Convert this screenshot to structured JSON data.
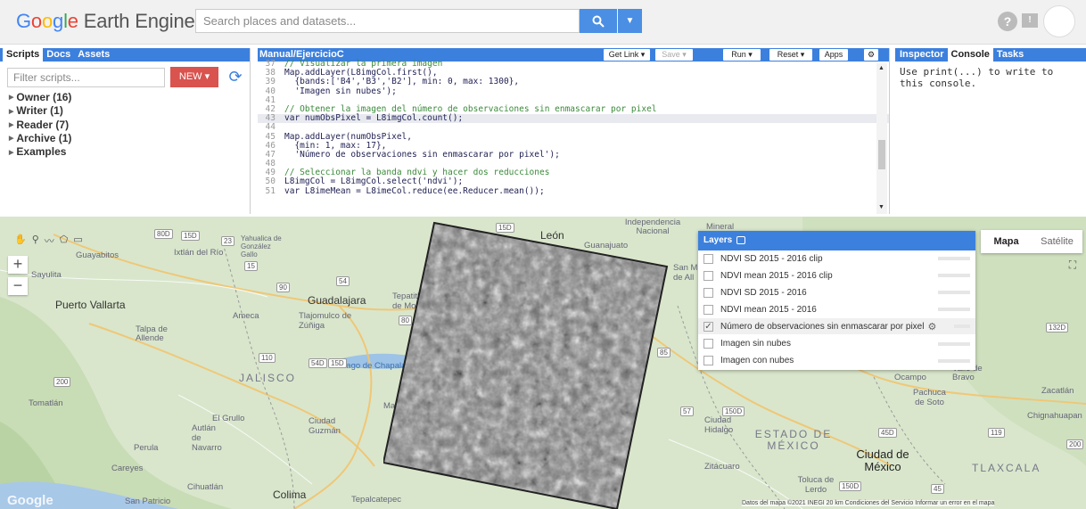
{
  "header": {
    "logo": {
      "g1": "G",
      "g2": "o",
      "g3": "o",
      "g4": "g",
      "g5": "l",
      "g6": "e",
      "rest": " Earth Engine"
    },
    "search_placeholder": "Search places and datasets...",
    "search_icon": "search-icon",
    "help": "?"
  },
  "left_panel": {
    "tabs": [
      "Scripts",
      "Docs",
      "Assets"
    ],
    "filter_placeholder": "Filter scripts...",
    "new_button": "NEW",
    "tree": [
      {
        "label": "Owner (16)"
      },
      {
        "label": "Writer (1)"
      },
      {
        "label": "Reader (7)"
      },
      {
        "label": "Archive (1)"
      },
      {
        "label": "Examples"
      }
    ]
  },
  "editor": {
    "title": "Manual/EjercicioC",
    "buttons": {
      "get_link": "Get Link",
      "save": "Save",
      "run": "Run",
      "reset": "Reset",
      "apps": "Apps"
    },
    "lines": [
      {
        "n": "37",
        "t": "// Visualizar la primera imagen",
        "kind": "comment"
      },
      {
        "n": "38",
        "t": "Map.addLayer(L8imgCol.first(),",
        "kind": "code"
      },
      {
        "n": "39",
        "t": "  {bands:['B4','B3','B2'], min: 0, max: 1300},",
        "kind": "code"
      },
      {
        "n": "40",
        "t": "  'Imagen sin nubes');",
        "kind": "code"
      },
      {
        "n": "41",
        "t": "",
        "kind": "code"
      },
      {
        "n": "42",
        "t": "// Obtener la imagen del número de observaciones sin enmascarar por pixel",
        "kind": "comment"
      },
      {
        "n": "43",
        "t": "var numObsPixel = L8imgCol.count();",
        "kind": "code",
        "highlight": true
      },
      {
        "n": "44",
        "t": "",
        "kind": "code"
      },
      {
        "n": "45",
        "t": "Map.addLayer(numObsPixel,",
        "kind": "code"
      },
      {
        "n": "46",
        "t": "  {min: 1, max: 17},",
        "kind": "code"
      },
      {
        "n": "47",
        "t": "  'Número de observaciones sin enmascarar por pixel');",
        "kind": "code"
      },
      {
        "n": "48",
        "t": "",
        "kind": "code"
      },
      {
        "n": "49",
        "t": "// Seleccionar la banda ndvi y hacer dos reducciones",
        "kind": "comment"
      },
      {
        "n": "50",
        "t": "L8imgCol = L8imgCol.select('ndvi');",
        "kind": "code"
      },
      {
        "n": "51",
        "t": "var L8imeMean = L8imeCol.reduce(ee.Reducer.mean());",
        "kind": "code"
      }
    ]
  },
  "right_panel": {
    "tabs": [
      "Inspector",
      "Console",
      "Tasks"
    ],
    "console_text": "Use print(...) to write to this console."
  },
  "map": {
    "maptype": {
      "map": "Mapa",
      "satellite": "Satélite"
    },
    "google": "Google",
    "attribution": "Datos del mapa ©2021 INEGI   20 km      Condiciones del Servicio   Informar un error en el mapa",
    "labels": [
      {
        "t": "Guadalajara",
        "c": "city"
      },
      {
        "t": "Puerto Vallarta",
        "c": "city"
      },
      {
        "t": "Tlajomulco de Zúñiga",
        "c": ""
      },
      {
        "t": "Ameca",
        "c": ""
      },
      {
        "t": "Tepatitlán de Mo",
        "c": ""
      },
      {
        "t": "JALISCO",
        "c": "state"
      },
      {
        "t": "Lago de Chapala",
        "c": ""
      },
      {
        "t": "León",
        "c": "city"
      },
      {
        "t": "Guanajuato",
        "c": ""
      },
      {
        "t": "Ciudad Guzmán",
        "c": ""
      },
      {
        "t": "Tomatlán",
        "c": ""
      },
      {
        "t": "El Grullo",
        "c": ""
      },
      {
        "t": "Autlán de Navarro",
        "c": ""
      },
      {
        "t": "Colima",
        "c": "city"
      },
      {
        "t": "Ciudad Hidalgo",
        "c": ""
      },
      {
        "t": "ESTADO DE MÉXICO",
        "c": "state"
      },
      {
        "t": "Ciudad de México",
        "c": "big"
      },
      {
        "t": "Toluca de Lerdo",
        "c": ""
      },
      {
        "t": "Zitácuaro",
        "c": ""
      },
      {
        "t": "Pachuca de Soto",
        "c": ""
      },
      {
        "t": "TLAXCALA",
        "c": "state"
      },
      {
        "t": "Talpa de Allende",
        "c": ""
      },
      {
        "t": "Yahualica de González Gallo",
        "c": ""
      },
      {
        "t": "San M de All",
        "c": ""
      },
      {
        "t": "Independencia Nacional",
        "c": ""
      },
      {
        "t": "Mineral",
        "c": ""
      },
      {
        "t": "Zacatlán",
        "c": ""
      },
      {
        "t": "Chignahuapan",
        "c": ""
      },
      {
        "t": "Tepalcatepec",
        "c": ""
      },
      {
        "t": "Perula",
        "c": ""
      },
      {
        "t": "Careyes",
        "c": ""
      },
      {
        "t": "Cihuatlán",
        "c": ""
      },
      {
        "t": "San Patricio",
        "c": ""
      },
      {
        "t": "Ocampo",
        "c": ""
      },
      {
        "t": "Valle de Bravo",
        "c": ""
      },
      {
        "t": "Mazamitla",
        "c": ""
      },
      {
        "t": "Sayulita",
        "c": ""
      },
      {
        "t": "Guayabitos",
        "c": ""
      },
      {
        "t": "Ixtlán del Río",
        "c": ""
      }
    ],
    "roads": [
      "80D",
      "15D",
      "23",
      "15",
      "90",
      "54",
      "80",
      "15D",
      "200",
      "110",
      "54D",
      "15D",
      "85",
      "57",
      "150D",
      "150D",
      "45",
      "45D",
      "132D",
      "119",
      "200"
    ]
  },
  "layers": {
    "title": "Layers",
    "items": [
      {
        "label": "NDVI SD 2015 - 2016 clip",
        "checked": false
      },
      {
        "label": "NDVI mean 2015 - 2016 clip",
        "checked": false
      },
      {
        "label": "NDVI SD 2015 - 2016",
        "checked": false
      },
      {
        "label": "NDVI mean 2015 - 2016",
        "checked": false
      },
      {
        "label": "Número de observaciones sin enmascarar por pixel",
        "checked": true,
        "highlight": true
      },
      {
        "label": "Imagen sin nubes",
        "checked": false
      },
      {
        "label": "Imagen con nubes",
        "checked": false
      }
    ]
  },
  "colors": {
    "accent": "#3c80de",
    "new_button": "#d9534f",
    "search_button": "#4a8fe4"
  }
}
